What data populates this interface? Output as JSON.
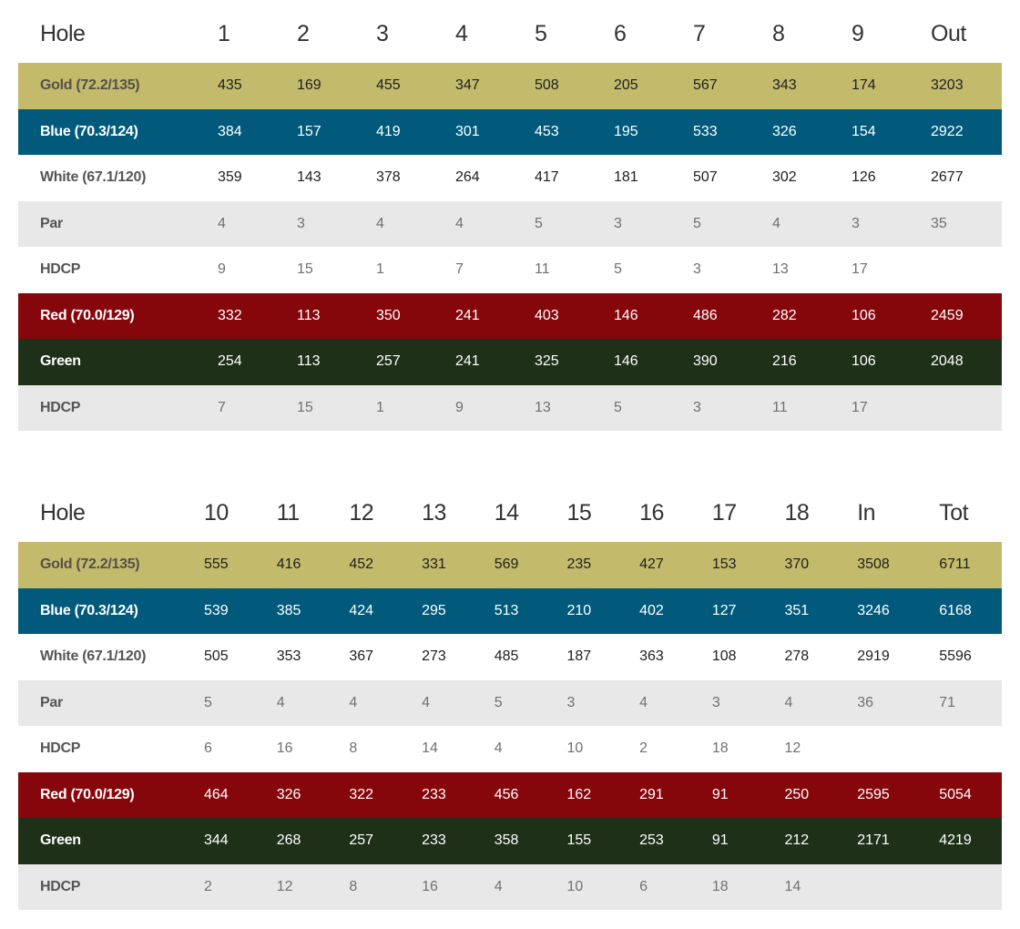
{
  "front_nine": {
    "header": [
      "Hole",
      "1",
      "2",
      "3",
      "4",
      "5",
      "6",
      "7",
      "8",
      "9",
      "Out"
    ],
    "rows": [
      {
        "theme": "gold",
        "label": "Gold (72.2/135)",
        "values": [
          "435",
          "169",
          "455",
          "347",
          "508",
          "205",
          "567",
          "343",
          "174",
          "3203"
        ]
      },
      {
        "theme": "blue",
        "label": "Blue (70.3/124)",
        "values": [
          "384",
          "157",
          "419",
          "301",
          "453",
          "195",
          "533",
          "326",
          "154",
          "2922"
        ]
      },
      {
        "theme": "white",
        "label": "White (67.1/120)",
        "values": [
          "359",
          "143",
          "378",
          "264",
          "417",
          "181",
          "507",
          "302",
          "126",
          "2677"
        ]
      },
      {
        "theme": "par",
        "label": "Par",
        "values": [
          "4",
          "3",
          "4",
          "4",
          "5",
          "3",
          "5",
          "4",
          "3",
          "35"
        ]
      },
      {
        "theme": "hdcp",
        "label": "HDCP",
        "values": [
          "9",
          "15",
          "1",
          "7",
          "11",
          "5",
          "3",
          "13",
          "17",
          ""
        ]
      },
      {
        "theme": "red",
        "label": "Red (70.0/129)",
        "values": [
          "332",
          "113",
          "350",
          "241",
          "403",
          "146",
          "486",
          "282",
          "106",
          "2459"
        ]
      },
      {
        "theme": "green",
        "label": "Green",
        "values": [
          "254",
          "113",
          "257",
          "241",
          "325",
          "146",
          "390",
          "216",
          "106",
          "2048"
        ]
      },
      {
        "theme": "hdcp2",
        "label": "HDCP",
        "values": [
          "7",
          "15",
          "1",
          "9",
          "13",
          "5",
          "3",
          "11",
          "17",
          ""
        ]
      }
    ]
  },
  "back_nine": {
    "header": [
      "Hole",
      "10",
      "11",
      "12",
      "13",
      "14",
      "15",
      "16",
      "17",
      "18",
      "In",
      "Tot"
    ],
    "rows": [
      {
        "theme": "gold",
        "label": "Gold (72.2/135)",
        "values": [
          "555",
          "416",
          "452",
          "331",
          "569",
          "235",
          "427",
          "153",
          "370",
          "3508",
          "6711"
        ]
      },
      {
        "theme": "blue",
        "label": "Blue (70.3/124)",
        "values": [
          "539",
          "385",
          "424",
          "295",
          "513",
          "210",
          "402",
          "127",
          "351",
          "3246",
          "6168"
        ]
      },
      {
        "theme": "white",
        "label": "White (67.1/120)",
        "values": [
          "505",
          "353",
          "367",
          "273",
          "485",
          "187",
          "363",
          "108",
          "278",
          "2919",
          "5596"
        ]
      },
      {
        "theme": "par",
        "label": "Par",
        "values": [
          "5",
          "4",
          "4",
          "4",
          "5",
          "3",
          "4",
          "3",
          "4",
          "36",
          "71"
        ]
      },
      {
        "theme": "hdcp",
        "label": "HDCP",
        "values": [
          "6",
          "16",
          "8",
          "14",
          "4",
          "10",
          "2",
          "18",
          "12",
          "",
          ""
        ]
      },
      {
        "theme": "red",
        "label": "Red (70.0/129)",
        "values": [
          "464",
          "326",
          "322",
          "233",
          "456",
          "162",
          "291",
          "91",
          "250",
          "2595",
          "5054"
        ]
      },
      {
        "theme": "green",
        "label": "Green",
        "values": [
          "344",
          "268",
          "257",
          "233",
          "358",
          "155",
          "253",
          "91",
          "212",
          "2171",
          "4219"
        ]
      },
      {
        "theme": "hdcp2",
        "label": "HDCP",
        "values": [
          "2",
          "12",
          "8",
          "16",
          "4",
          "10",
          "6",
          "18",
          "14",
          "",
          ""
        ]
      }
    ]
  },
  "colors": {
    "gold": "#c3bb6b",
    "blue": "#015a7c",
    "red": "#86070b",
    "green": "#1e3018",
    "light_gray": "#e8e8e8"
  }
}
